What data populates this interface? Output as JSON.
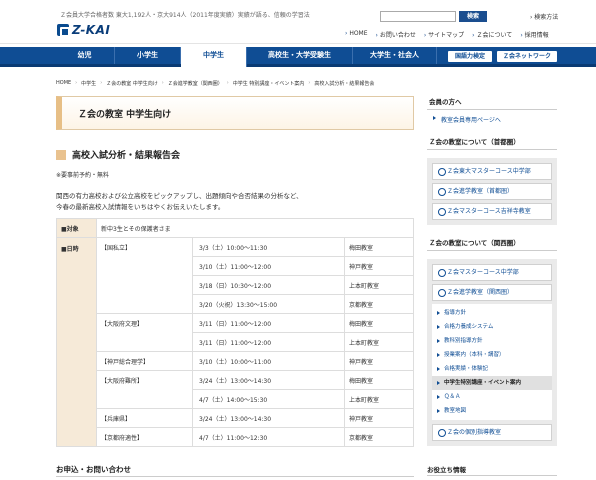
{
  "header": {
    "tagline": "Ｚ会員大学合格者数 東大1,192人・京大914人（2011年度実績）実績が語る、信頼の学習法",
    "logo_text": "Z-KAI",
    "search_button": "検索",
    "search_method": "› 検索方法",
    "links": [
      "HOME",
      "お問い合わせ",
      "サイトマップ",
      "Ｚ会について",
      "採用情報"
    ]
  },
  "nav": {
    "items": [
      "幼児",
      "小学生",
      "中学生",
      "高校生・大学受験生",
      "大学生・社会人"
    ],
    "active": "中学生",
    "buttons": [
      "国語力検定",
      "Ｚ会ネットワーク"
    ]
  },
  "breadcrumb": [
    "HOME",
    "中学生",
    "Ｚ会の教室 中学生向け",
    "Ｚ会進学教室（関西圏）",
    "中学生 特別講座・イベント案内",
    "高校入試分析・結果報告会"
  ],
  "main": {
    "page_title": "Ｚ会の教室 中学生向け",
    "section_title": "高校入試分析・結果報告会",
    "note": "※要事前予約・無料",
    "desc_line1": "関西の有力高校および公立高校をピックアップし、出題傾向や合否結果の分析など、",
    "desc_line2": "今春の最新高校入試情報をいちはやくお伝えいたします。"
  },
  "table": {
    "target_label": "■対象",
    "target_value": "新中3生とその保護者さま",
    "date_label": "■日時",
    "rows": [
      {
        "school": "【国私立】",
        "date": "3/3（土）10:00～11:30",
        "place": "梅田教室"
      },
      {
        "school": "",
        "date": "3/10（土）11:00～12:00",
        "place": "神戸教室"
      },
      {
        "school": "",
        "date": "3/18（日）10:30～12:00",
        "place": "上本町教室"
      },
      {
        "school": "",
        "date": "3/20（火祝）13:30～15:00",
        "place": "京都教室"
      },
      {
        "school": "【大阪府文理】",
        "date": "3/11（日）11:00～12:00",
        "place": "梅田教室"
      },
      {
        "school": "",
        "date": "3/11（日）11:00～12:00",
        "place": "上本町教室"
      },
      {
        "school": "【神戸総合理学】",
        "date": "3/10（土）10:00～11:00",
        "place": "神戸教室"
      },
      {
        "school": "【大阪府難所】",
        "date": "3/24（土）13:00～14:30",
        "place": "梅田教室"
      },
      {
        "school": "",
        "date": "4/7（土）14:00～15:30",
        "place": "上本町教室"
      },
      {
        "school": "【兵庫県】",
        "date": "3/24（土）13:00～14:30",
        "place": "神戸教室"
      },
      {
        "school": "【京都府適性】",
        "date": "4/7（土）11:00～12:30",
        "place": "京都教室"
      }
    ]
  },
  "footer": {
    "contact_heading": "お申込・お問い合わせ",
    "side_heading": "お役立ち情報"
  },
  "sidebar": {
    "members_heading": "会員の方へ",
    "members_link": "教室会員専用ページへ",
    "shutoken_heading": "Ｚ会の教室について（首都圏）",
    "shutoken_cards": [
      "Ｚ会東大マスターコース中学部",
      "Ｚ会進学教室（首都圏）",
      "Ｚ会マスターコース吉祥寺教室"
    ],
    "kansai_heading": "Ｚ会の教室について（関西圏）",
    "kansai_cards": [
      "Ｚ会マスターコース中学部",
      "Ｚ会進学教室（関西圏）"
    ],
    "kansai_subitems": [
      "指導方針",
      "合格力養成システム",
      "教科別指導方針",
      "授業案内（本科・講習）",
      "合格実績・体験記",
      "中学生特別講座・イベント案内",
      "Ｑ＆Ａ",
      "教室地図"
    ],
    "kansai_current": "中学生特別講座・イベント案内",
    "extra_card": "Ｚ会の個別指導教室"
  }
}
